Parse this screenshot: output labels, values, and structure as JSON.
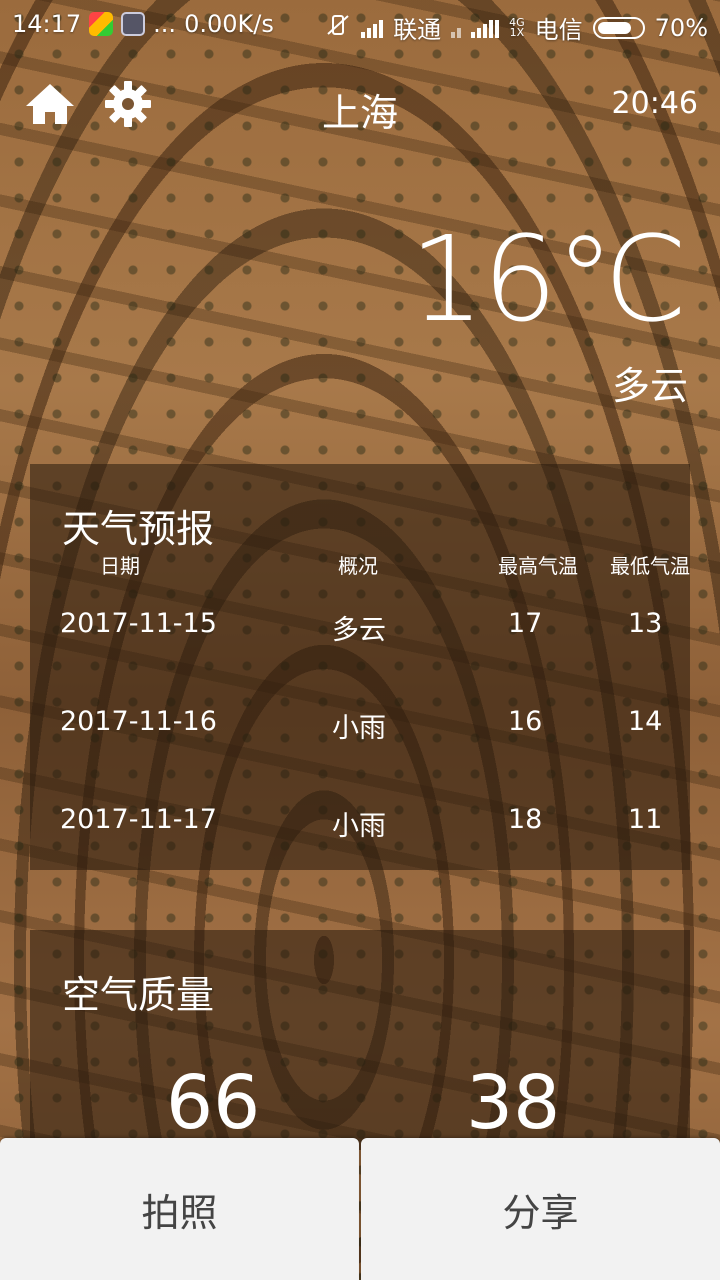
{
  "status_bar": {
    "time": "14:17",
    "dots": "...",
    "speed": "0.00K/s",
    "carrier1": "联通",
    "net_type_top": "4G",
    "net_type_bottom": "1X",
    "carrier2": "电信",
    "battery": "70%"
  },
  "header": {
    "city": "上海",
    "time": "20:46"
  },
  "current": {
    "temperature": "16℃",
    "condition": "多云"
  },
  "forecast": {
    "title": "天气预报",
    "columns": [
      "日期",
      "概况",
      "最高气温",
      "最低气温"
    ],
    "rows": [
      {
        "date": "2017-11-15",
        "desc": "多云",
        "high": "17",
        "low": "13"
      },
      {
        "date": "2017-11-16",
        "desc": "小雨",
        "high": "16",
        "low": "14"
      },
      {
        "date": "2017-11-17",
        "desc": "小雨",
        "high": "18",
        "low": "11"
      }
    ]
  },
  "air_quality": {
    "title": "空气质量",
    "values": [
      "66",
      "38"
    ]
  },
  "buttons": {
    "photo": "拍照",
    "share": "分享"
  }
}
